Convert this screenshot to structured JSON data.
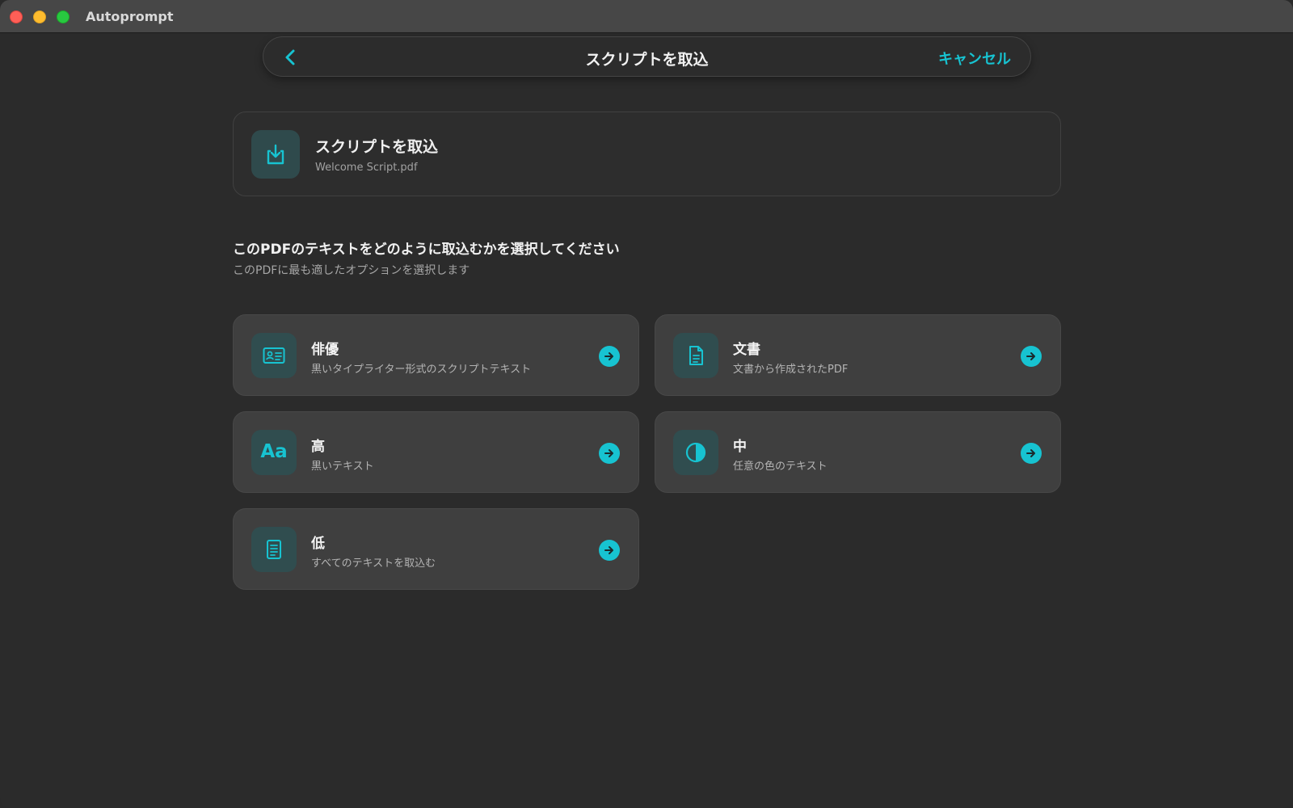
{
  "window": {
    "app_title": "Autoprompt"
  },
  "nav": {
    "title": "スクリプトを取込",
    "cancel_label": "キャンセル"
  },
  "file": {
    "title": "スクリプトを取込",
    "name": "Welcome Script.pdf"
  },
  "section": {
    "title": "このPDFのテキストをどのように取込むかを選択してください",
    "subtitle": "このPDFに最も適したオプションを選択します"
  },
  "options": [
    {
      "title": "俳優",
      "desc": "黒いタイプライター形式のスクリプトテキスト",
      "icon": "contact-card-icon"
    },
    {
      "title": "文書",
      "desc": "文書から作成されたPDF",
      "icon": "document-icon"
    },
    {
      "title": "高",
      "desc": "黒いテキスト",
      "icon": "text-aa-icon",
      "icon_text": "Aa"
    },
    {
      "title": "中",
      "desc": "任意の色のテキスト",
      "icon": "contrast-icon"
    },
    {
      "title": "低",
      "desc": "すべてのテキストを取込む",
      "icon": "text-page-icon"
    }
  ],
  "colors": {
    "accent": "#17c3d1",
    "background": "#2b2b2b",
    "card": "#3f3f3f"
  }
}
